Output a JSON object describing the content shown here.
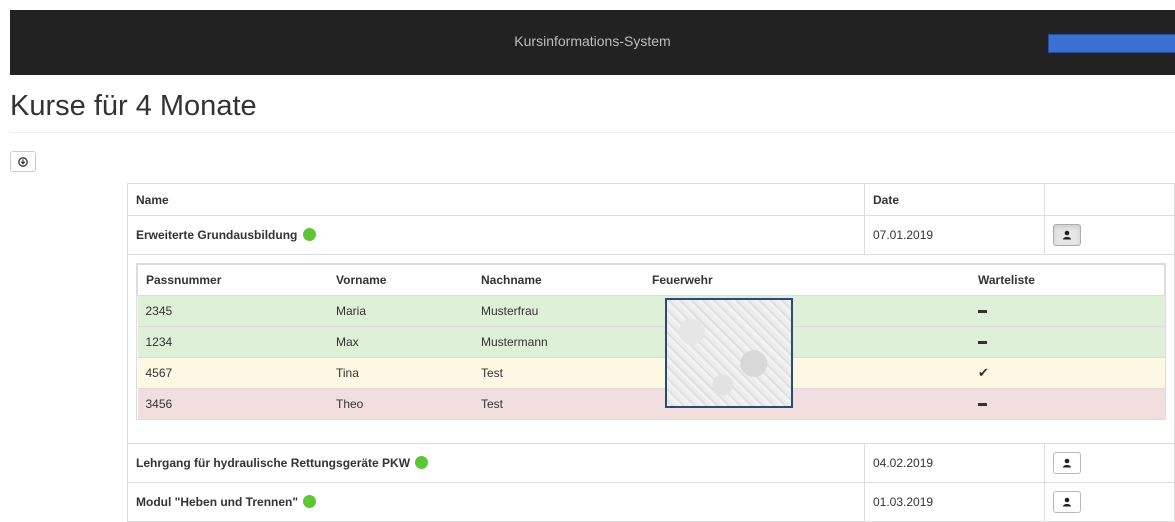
{
  "navbar": {
    "title": "Kursinformations-System"
  },
  "page": {
    "title": "Kurse für 4 Monate"
  },
  "course_table": {
    "headers": {
      "name": "Name",
      "date": "Date"
    },
    "courses": [
      {
        "name": "Erweiterte Grundausbildung",
        "date": "07.01.2019"
      },
      {
        "name": "Lehrgang für hydraulische Rettungsgeräte PKW",
        "date": "04.02.2019"
      },
      {
        "name": "Modul \"Heben und Trennen\"",
        "date": "01.03.2019"
      }
    ]
  },
  "participants": {
    "headers": {
      "passnummer": "Passnummer",
      "vorname": "Vorname",
      "nachname": "Nachname",
      "feuerwehr": "Feuerwehr",
      "warteliste": "Warteliste"
    },
    "rows": [
      {
        "passnummer": "2345",
        "vorname": "Maria",
        "nachname": "Musterfrau",
        "warteliste": "dash",
        "status": "success"
      },
      {
        "passnummer": "1234",
        "vorname": "Max",
        "nachname": "Mustermann",
        "warteliste": "dash",
        "status": "success"
      },
      {
        "passnummer": "4567",
        "vorname": "Tina",
        "nachname": "Test",
        "warteliste": "check",
        "status": "warning"
      },
      {
        "passnummer": "3456",
        "vorname": "Theo",
        "nachname": "Test",
        "warteliste": "dash",
        "status": "danger"
      }
    ]
  },
  "colors": {
    "navbar": "#222222",
    "status_dot": "#5cc634",
    "row_success": "#dff0d8",
    "row_warning": "#fcf8e3",
    "row_danger": "#f2dede"
  },
  "icons": {
    "download": "download-icon",
    "user": "user-icon",
    "status": "status-dot-icon",
    "dash": "dash-icon",
    "check": "check-icon"
  }
}
